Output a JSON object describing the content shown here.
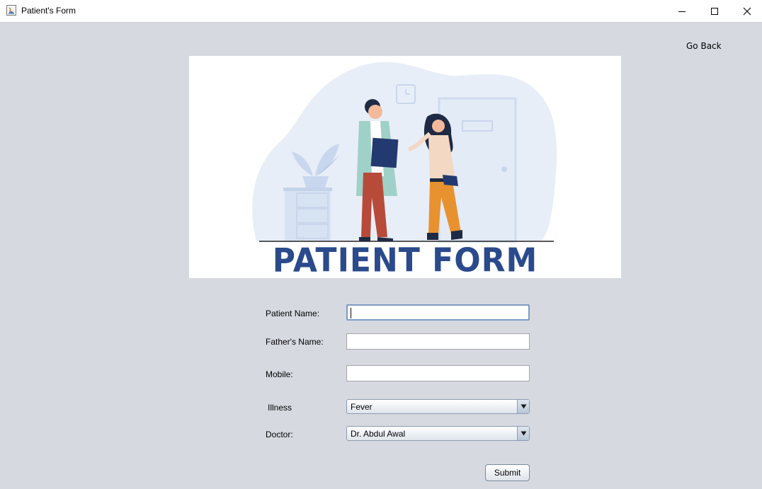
{
  "window": {
    "title": "Patient's Form"
  },
  "nav": {
    "go_back": "Go Back"
  },
  "banner": {
    "title": "PATIENT FORM"
  },
  "form": {
    "patient_name": {
      "label": "Patient Name:",
      "value": ""
    },
    "father_name": {
      "label": "Father's Name:",
      "value": ""
    },
    "mobile": {
      "label": "Mobile:",
      "value": ""
    },
    "illness": {
      "label": "Illness",
      "selected": "Fever"
    },
    "doctor": {
      "label": "Doctor:",
      "selected": "Dr. Abdul Awal"
    },
    "submit_label": "Submit"
  },
  "icons": {
    "app": "java-app-icon",
    "minimize": "minimize-icon",
    "maximize": "maximize-icon",
    "close": "close-icon",
    "dropdown": "chevron-down-icon"
  },
  "colors": {
    "background": "#d6d9e0",
    "banner_title": "#2a4a8c",
    "focus_border": "#7d9ac2"
  }
}
